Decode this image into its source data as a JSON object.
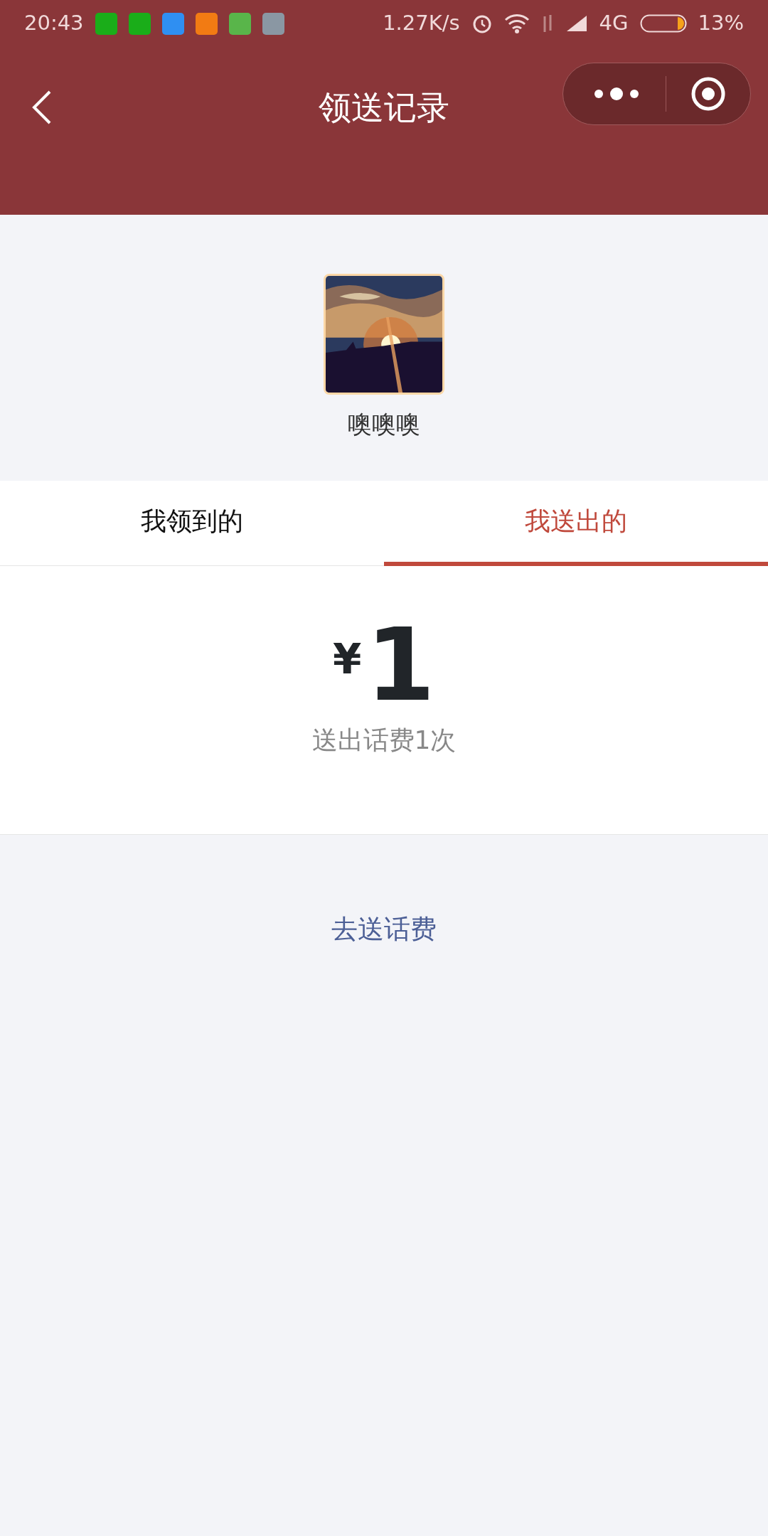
{
  "status_bar": {
    "time": "20:43",
    "speed": "1.27K/s",
    "network": "4G",
    "battery": "13%"
  },
  "header": {
    "title": "领送记录"
  },
  "profile": {
    "name": "噢噢噢"
  },
  "tabs": [
    {
      "label": "我领到的",
      "selected": false
    },
    {
      "label": "我送出的",
      "selected": true
    }
  ],
  "summary": {
    "currency": "¥",
    "amount": "1",
    "caption": "送出话费1次"
  },
  "link": "去送话费"
}
